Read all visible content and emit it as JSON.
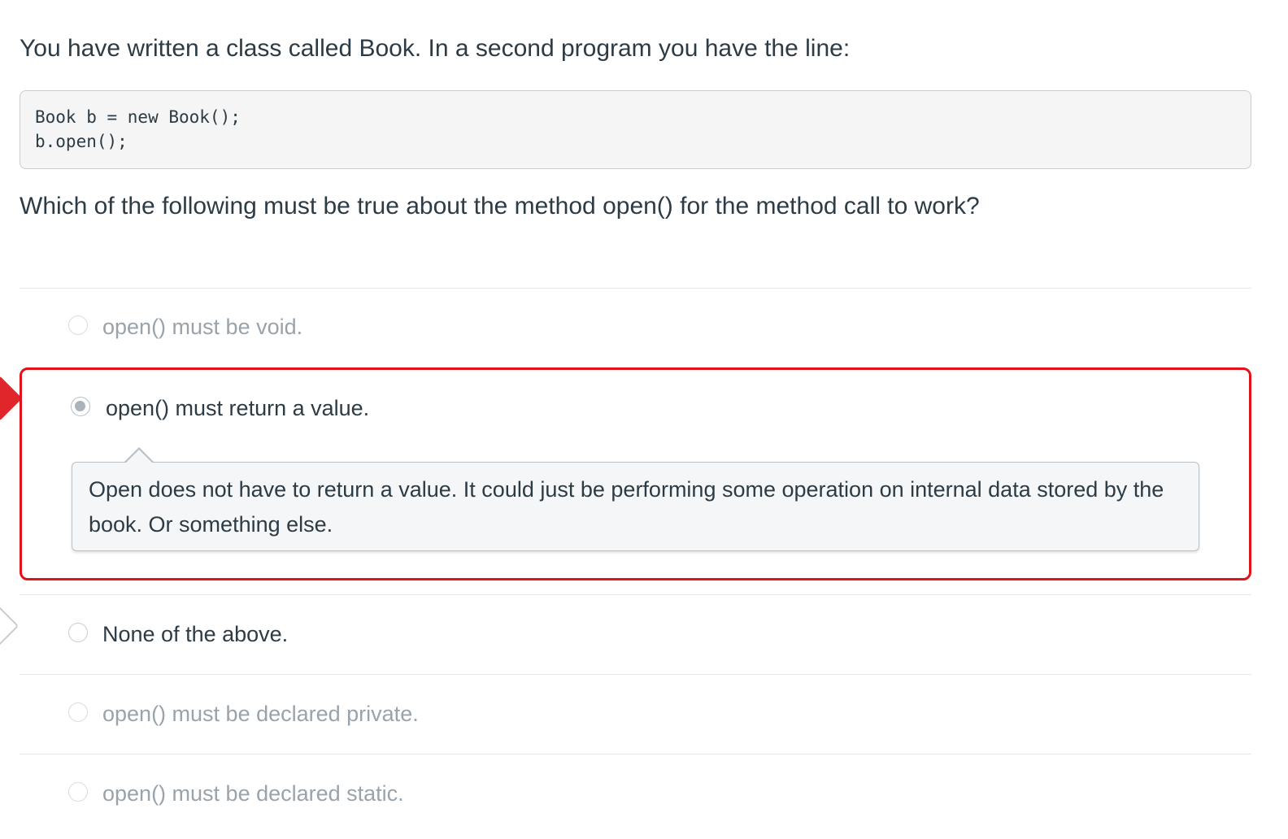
{
  "question": {
    "intro": "You have written a class called Book. In a second program you have the line:",
    "code_lines": [
      "Book b = new Book();",
      "b.open();"
    ],
    "prompt": "Which of the following must be true about the method open() for the method call to work?"
  },
  "answers": [
    {
      "label": "open() must be void.",
      "selected": false,
      "dimmed": true
    },
    {
      "label": "open() must return a value.",
      "selected": true,
      "dimmed": false,
      "result": "incorrect",
      "comment": "Open does not have to return a value. It could just be performing some operation on internal data stored by the book. Or something else."
    },
    {
      "label": "None of the above.",
      "selected": false,
      "dimmed": false,
      "result": "correct-answer"
    },
    {
      "label": "open() must be declared private.",
      "selected": false,
      "dimmed": true
    },
    {
      "label": "open() must be declared static.",
      "selected": false,
      "dimmed": true
    }
  ],
  "colors": {
    "text": "#2d3b45",
    "dim_text": "#9aa3aa",
    "incorrect_highlight": "#e0131b",
    "code_background": "#f5f5f5",
    "comment_background": "#f5f6f7"
  },
  "icons": {
    "incorrect_marker": "red-diamond-icon",
    "correct_marker": "outline-diamond-icon",
    "radio": "radio-button-icon"
  }
}
